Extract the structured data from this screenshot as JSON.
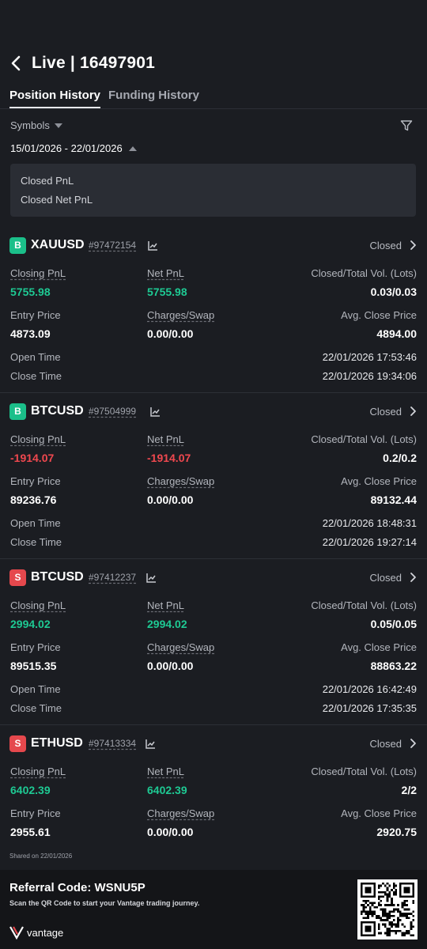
{
  "header": {
    "title": "Live | 16497901"
  },
  "tabs": [
    {
      "label": "Position History",
      "active": true
    },
    {
      "label": "Funding History",
      "active": false
    }
  ],
  "filters": {
    "symbols_label": "Symbols",
    "date_range": "15/01/2026 - 22/01/2026"
  },
  "summary": {
    "closed_pnl": "Closed PnL",
    "closed_net_pnl": "Closed Net PnL"
  },
  "labels": {
    "closing_pnl": "Closing PnL",
    "net_pnl": "Net PnL",
    "vol": "Closed/Total Vol. (Lots)",
    "entry_price": "Entry Price",
    "charges_swap": "Charges/Swap",
    "avg_close": "Avg. Close Price",
    "open_time": "Open Time",
    "close_time": "Close Time"
  },
  "positions": [
    {
      "side": "B",
      "symbol": "XAUUSD",
      "order": "#97472154",
      "status": "Closed",
      "closing_pnl": "5755.98",
      "net_pnl": "5755.98",
      "vol": "0.03/0.03",
      "entry_price": "4873.09",
      "charges_swap": "0.00/0.00",
      "avg_close": "4894.00",
      "open_time": "22/01/2026 17:53:46",
      "close_time": "22/01/2026 19:34:06"
    },
    {
      "side": "B",
      "symbol": "BTCUSD",
      "order": "#97504999",
      "status": "Closed",
      "closing_pnl": "-1914.07",
      "net_pnl": "-1914.07",
      "vol": "0.2/0.2",
      "entry_price": "89236.76",
      "charges_swap": "0.00/0.00",
      "avg_close": "89132.44",
      "open_time": "22/01/2026 18:48:31",
      "close_time": "22/01/2026 19:27:14"
    },
    {
      "side": "S",
      "symbol": "BTCUSD",
      "order": "#97412237",
      "status": "Closed",
      "closing_pnl": "2994.02",
      "net_pnl": "2994.02",
      "vol": "0.05/0.05",
      "entry_price": "89515.35",
      "charges_swap": "0.00/0.00",
      "avg_close": "88863.22",
      "open_time": "22/01/2026 16:42:49",
      "close_time": "22/01/2026 17:35:35"
    },
    {
      "side": "S",
      "symbol": "ETHUSD",
      "order": "#97413334",
      "status": "Closed",
      "closing_pnl": "6402.39",
      "net_pnl": "6402.39",
      "vol": "2/2",
      "entry_price": "2955.61",
      "charges_swap": "0.00/0.00",
      "avg_close": "2920.75"
    }
  ],
  "shared_on": "Shared on 22/01/2026",
  "footer": {
    "referral": "Referral Code: WSNU5P",
    "subtitle": "Scan the QR Code to start your Vantage trading journey.",
    "brand": "vantage"
  },
  "colors": {
    "buy": "#1bbf8a",
    "sell": "#e5484d",
    "positive": "#1ec993",
    "negative": "#f0484f"
  }
}
